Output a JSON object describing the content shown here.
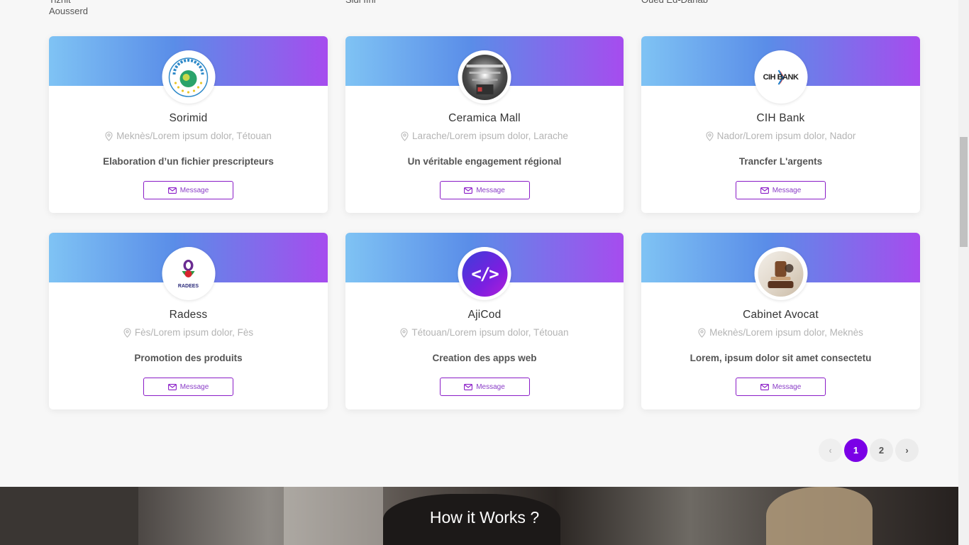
{
  "top_locations": {
    "col1": [
      "Tiznit",
      "Aousserd"
    ],
    "col2": [
      "Sidi Ifni"
    ],
    "col3": [
      "Oued Ed-Dahab"
    ]
  },
  "colors": {
    "accent": "#7a00e6",
    "button_border": "#8a1cc7",
    "banner_start": "#7fc3f4",
    "banner_end": "#a64cee"
  },
  "cards": [
    {
      "name": "Sorimid",
      "location": "Meknès/Lorem ipsum dolor, Tétouan",
      "description": "Elaboration d’un fichier prescripteurs",
      "button": "Message",
      "logo": "soremed-logo"
    },
    {
      "name": "Ceramica Mall",
      "location": "Larache/Lorem ipsum dolor, Larache",
      "description": "Un véritable engagement régional",
      "button": "Message",
      "logo": "mall-photo"
    },
    {
      "name": "CIH Bank",
      "location": "Nador/Lorem ipsum dolor, Nador",
      "description": "Trancfer L'argents",
      "button": "Message",
      "logo": "cih-bank-logo",
      "logo_text": "CIH BANK"
    },
    {
      "name": "Radess",
      "location": "Fès/Lorem ipsum dolor, Fès",
      "description": "Promotion des produits",
      "button": "Message",
      "logo": "radees-logo",
      "logo_text": "RADEES"
    },
    {
      "name": "AjiCod",
      "location": "Tétouan/Lorem ipsum dolor, Tétouan",
      "description": "Creation des apps web",
      "button": "Message",
      "logo": "code-icon",
      "logo_text": "</>"
    },
    {
      "name": "Cabinet Avocat",
      "location": "Meknès/Lorem ipsum dolor, Meknès",
      "description": "Lorem, ipsum dolor sit amet consectetu",
      "button": "Message",
      "logo": "law-scale-photo"
    }
  ],
  "pagination": {
    "prev": "‹",
    "pages": [
      "1",
      "2"
    ],
    "current": "1",
    "next": "›"
  },
  "how_section": {
    "title": "How it Works ?"
  }
}
